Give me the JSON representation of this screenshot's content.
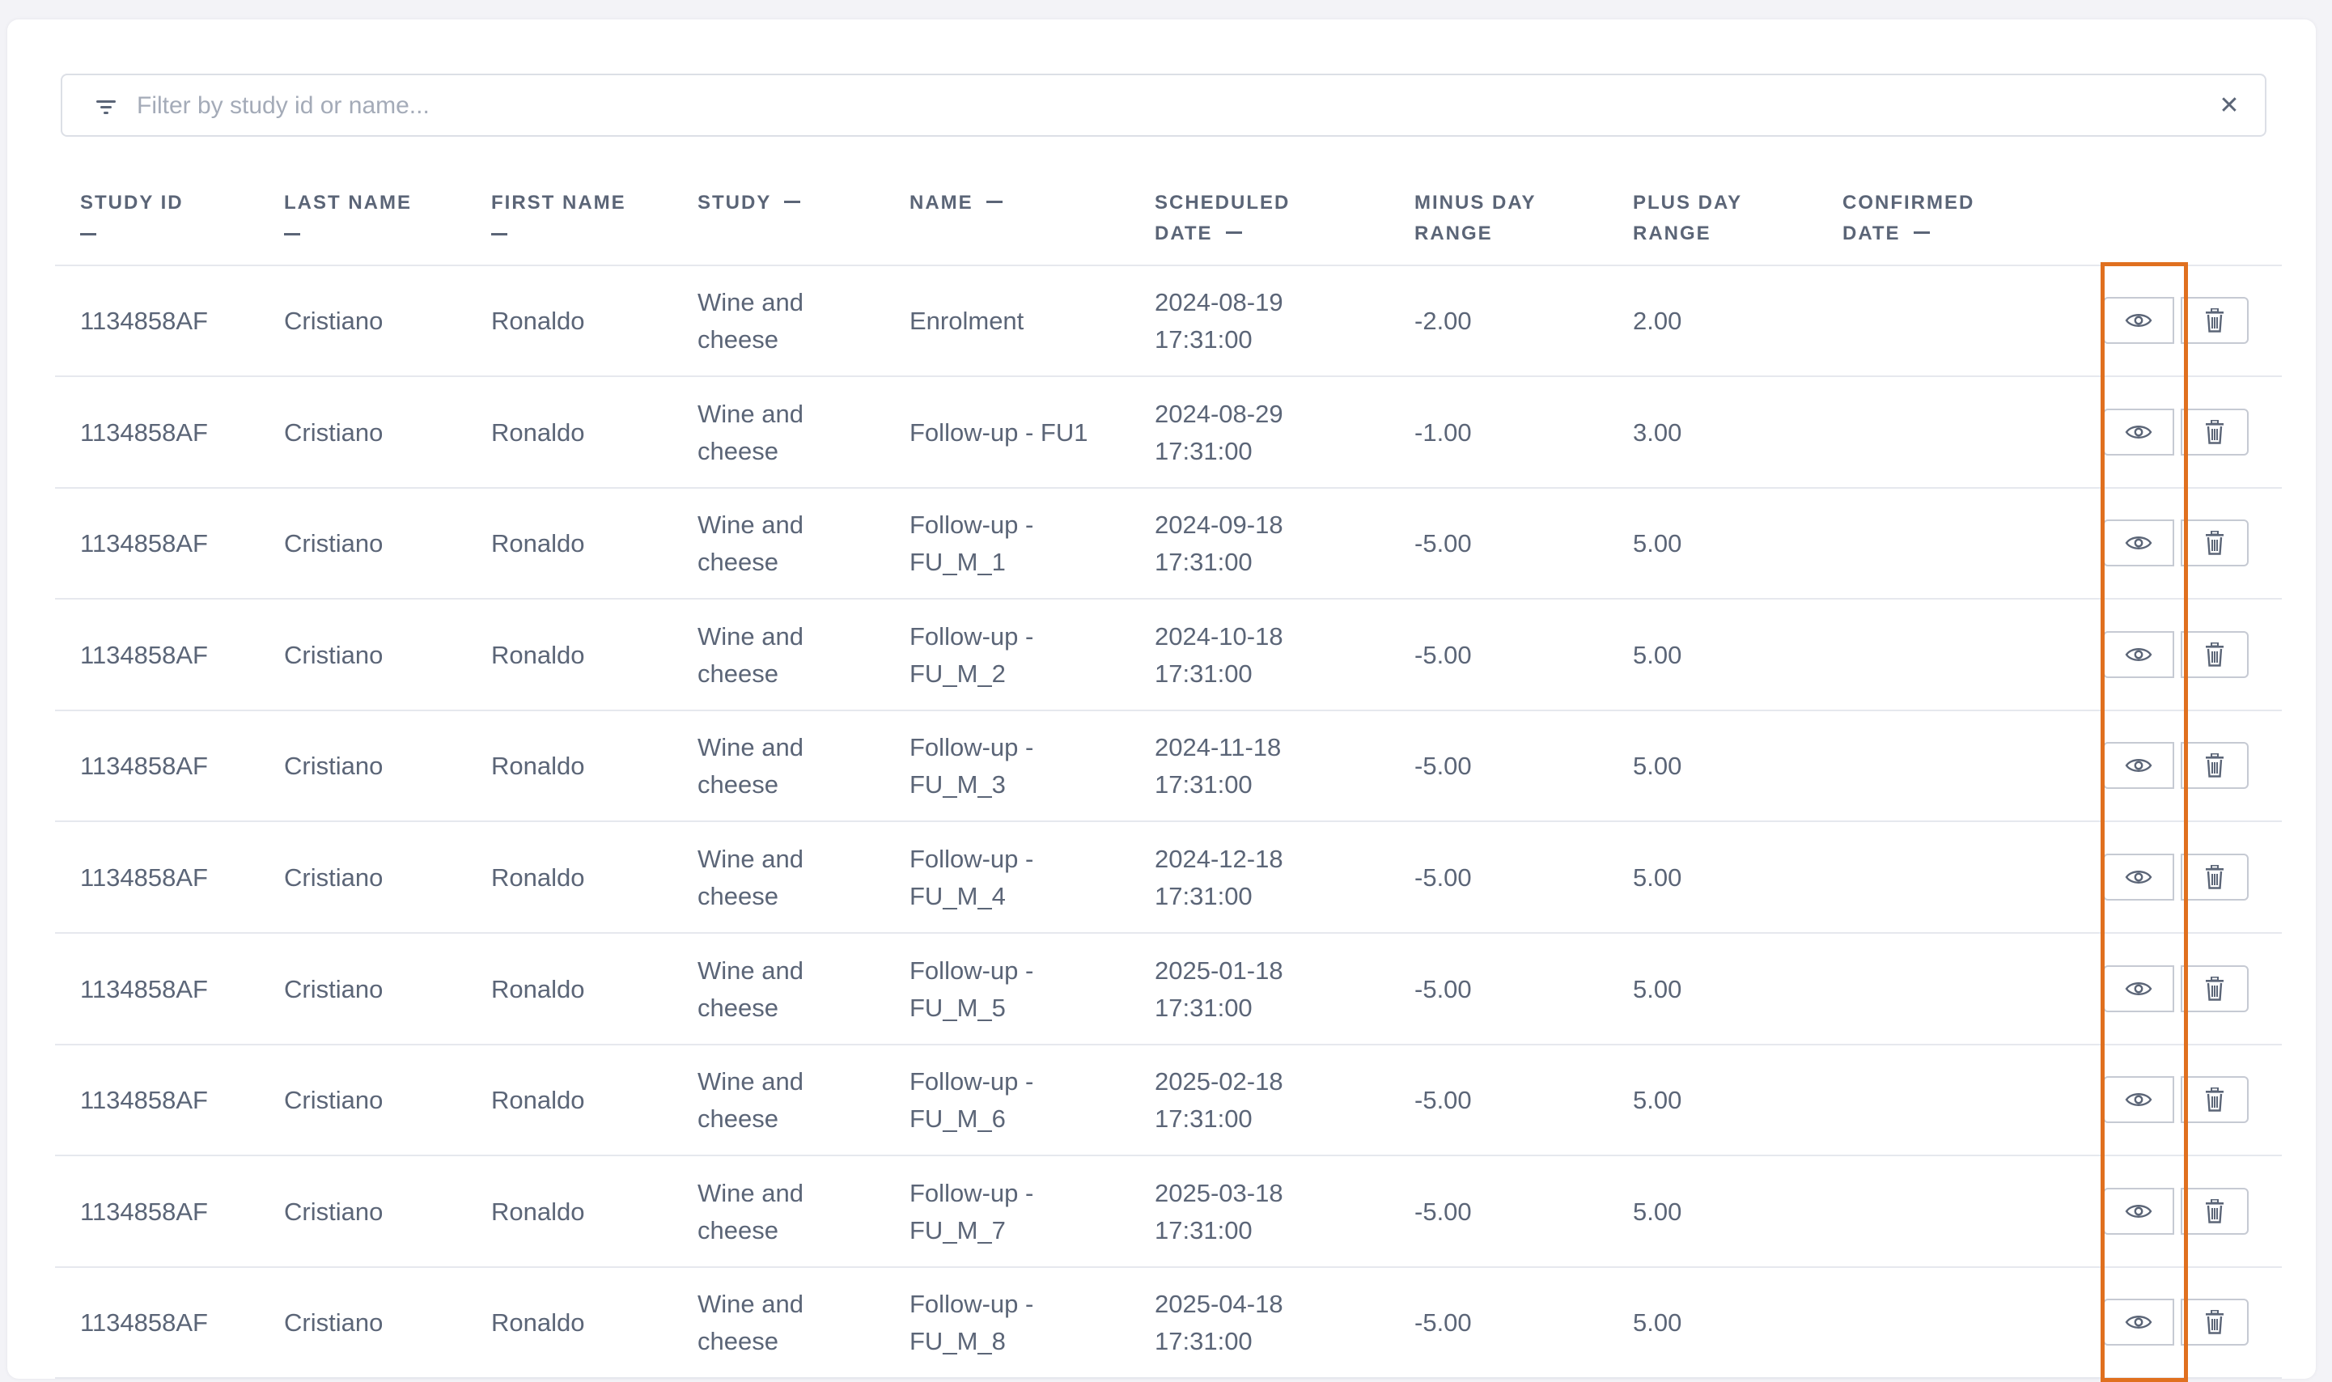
{
  "filter": {
    "placeholder": "Filter by study id or name..."
  },
  "columns": {
    "study_id": [
      "STUDY ID"
    ],
    "last_name": [
      "LAST NAME"
    ],
    "first_name": [
      "FIRST NAME"
    ],
    "study": [
      "STUDY"
    ],
    "name": [
      "NAME"
    ],
    "scheduled_date": [
      "SCHEDULED",
      "DATE"
    ],
    "minus_day_range": [
      "MINUS DAY",
      "RANGE"
    ],
    "plus_day_range": [
      "PLUS DAY",
      "RANGE"
    ],
    "confirmed_date": [
      "CONFIRMED",
      "DATE"
    ]
  },
  "rows": [
    {
      "study_id": "1134858AF",
      "last_name": "Cristiano",
      "first_name": "Ronaldo",
      "study": [
        "Wine and",
        "cheese"
      ],
      "name": [
        "Enrolment"
      ],
      "scheduled_date": [
        "2024-08-19",
        "17:31:00"
      ],
      "minus": "-2.00",
      "plus": "2.00"
    },
    {
      "study_id": "1134858AF",
      "last_name": "Cristiano",
      "first_name": "Ronaldo",
      "study": [
        "Wine and",
        "cheese"
      ],
      "name": [
        "Follow-up - FU1"
      ],
      "scheduled_date": [
        "2024-08-29",
        "17:31:00"
      ],
      "minus": "-1.00",
      "plus": "3.00"
    },
    {
      "study_id": "1134858AF",
      "last_name": "Cristiano",
      "first_name": "Ronaldo",
      "study": [
        "Wine and",
        "cheese"
      ],
      "name": [
        "Follow-up -",
        "FU_M_1"
      ],
      "scheduled_date": [
        "2024-09-18",
        "17:31:00"
      ],
      "minus": "-5.00",
      "plus": "5.00"
    },
    {
      "study_id": "1134858AF",
      "last_name": "Cristiano",
      "first_name": "Ronaldo",
      "study": [
        "Wine and",
        "cheese"
      ],
      "name": [
        "Follow-up -",
        "FU_M_2"
      ],
      "scheduled_date": [
        "2024-10-18",
        "17:31:00"
      ],
      "minus": "-5.00",
      "plus": "5.00"
    },
    {
      "study_id": "1134858AF",
      "last_name": "Cristiano",
      "first_name": "Ronaldo",
      "study": [
        "Wine and",
        "cheese"
      ],
      "name": [
        "Follow-up -",
        "FU_M_3"
      ],
      "scheduled_date": [
        "2024-11-18",
        "17:31:00"
      ],
      "minus": "-5.00",
      "plus": "5.00"
    },
    {
      "study_id": "1134858AF",
      "last_name": "Cristiano",
      "first_name": "Ronaldo",
      "study": [
        "Wine and",
        "cheese"
      ],
      "name": [
        "Follow-up -",
        "FU_M_4"
      ],
      "scheduled_date": [
        "2024-12-18",
        "17:31:00"
      ],
      "minus": "-5.00",
      "plus": "5.00"
    },
    {
      "study_id": "1134858AF",
      "last_name": "Cristiano",
      "first_name": "Ronaldo",
      "study": [
        "Wine and",
        "cheese"
      ],
      "name": [
        "Follow-up -",
        "FU_M_5"
      ],
      "scheduled_date": [
        "2025-01-18",
        "17:31:00"
      ],
      "minus": "-5.00",
      "plus": "5.00"
    },
    {
      "study_id": "1134858AF",
      "last_name": "Cristiano",
      "first_name": "Ronaldo",
      "study": [
        "Wine and",
        "cheese"
      ],
      "name": [
        "Follow-up -",
        "FU_M_6"
      ],
      "scheduled_date": [
        "2025-02-18",
        "17:31:00"
      ],
      "minus": "-5.00",
      "plus": "5.00"
    },
    {
      "study_id": "1134858AF",
      "last_name": "Cristiano",
      "first_name": "Ronaldo",
      "study": [
        "Wine and",
        "cheese"
      ],
      "name": [
        "Follow-up -",
        "FU_M_7"
      ],
      "scheduled_date": [
        "2025-03-18",
        "17:31:00"
      ],
      "minus": "-5.00",
      "plus": "5.00"
    },
    {
      "study_id": "1134858AF",
      "last_name": "Cristiano",
      "first_name": "Ronaldo",
      "study": [
        "Wine and",
        "cheese"
      ],
      "name": [
        "Follow-up -",
        "FU_M_8"
      ],
      "scheduled_date": [
        "2025-04-18",
        "17:31:00"
      ],
      "minus": "-5.00",
      "plus": "5.00"
    }
  ],
  "row_actions": [
    "eye-icon",
    "trash-icon"
  ],
  "colors": {
    "highlight": "#e0701f",
    "text": "#5b6577",
    "border": "#c6cad3"
  }
}
